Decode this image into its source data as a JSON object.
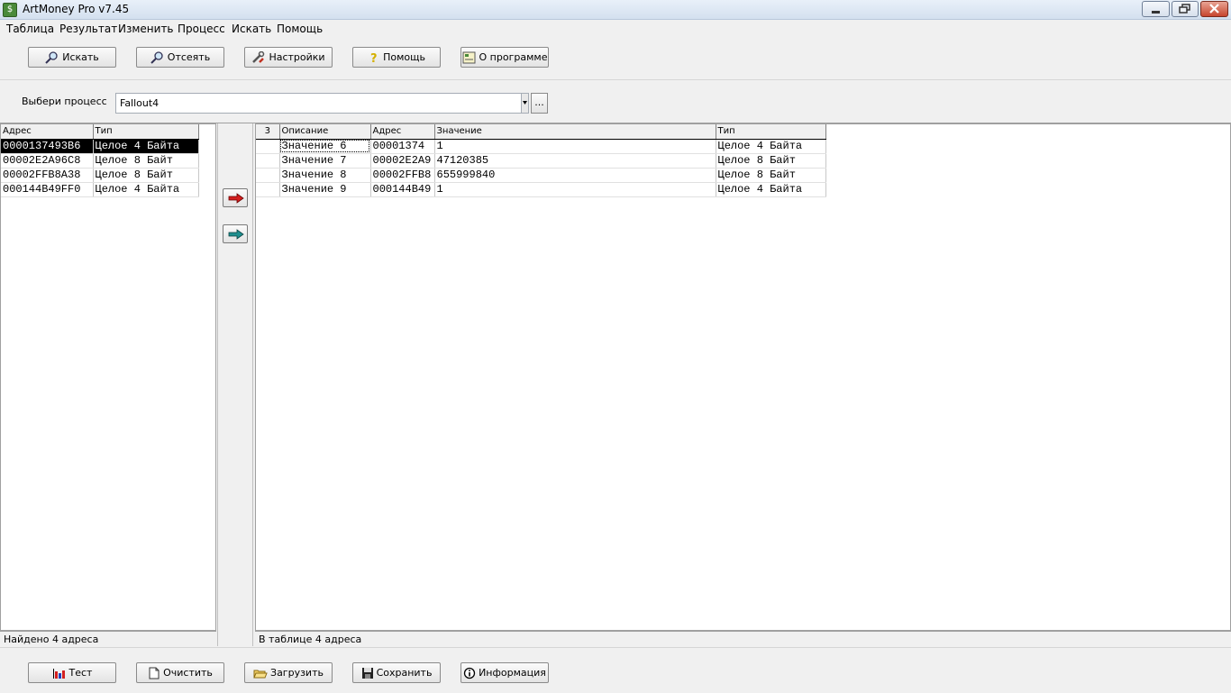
{
  "window": {
    "title": "ArtMoney Pro v7.45"
  },
  "menu": [
    "Таблица",
    "Результат",
    "Изменить",
    "Процесс",
    "Искать",
    "Помощь"
  ],
  "toolbar": {
    "search": "Искать",
    "filter": "Отсеять",
    "settings": "Настройки",
    "help": "Помощь",
    "about": "О программе"
  },
  "process": {
    "label": "Выбери процесс",
    "selected": "Fallout4",
    "browse": "..."
  },
  "left_table": {
    "headers": [
      "Адрес",
      "Тип"
    ],
    "rows": [
      [
        "0000137493B6",
        "Целое 4 Байта"
      ],
      [
        "00002E2A96C8",
        "Целое 8 Байт"
      ],
      [
        "00002FFB8A38",
        "Целое 8 Байт"
      ],
      [
        "000144B49FF0",
        "Целое 4 Байта"
      ]
    ],
    "status": "Найдено 4 адреса"
  },
  "right_table": {
    "corner": "3",
    "headers": [
      "Описание",
      "Адрес",
      "Значение",
      "Тип"
    ],
    "rows": [
      [
        "Значение 6",
        "00001374",
        "1",
        "Целое 4 Байта"
      ],
      [
        "Значение 7",
        "00002E2A9",
        "47120385",
        "Целое 8 Байт"
      ],
      [
        "Значение 8",
        "00002FFB8",
        "655999840",
        "Целое 8 Байт"
      ],
      [
        "Значение 9",
        "000144B49",
        "1",
        "Целое 4 Байта"
      ]
    ],
    "status": "В таблице 4 адреса"
  },
  "bottom_toolbar": {
    "test": "Тест",
    "clear": "Очистить",
    "load": "Загрузить",
    "save": "Сохранить",
    "info": "Информация"
  },
  "colors": {
    "selection": "#000000",
    "arrow_red": "#d42020",
    "arrow_teal": "#1f8f8f"
  }
}
